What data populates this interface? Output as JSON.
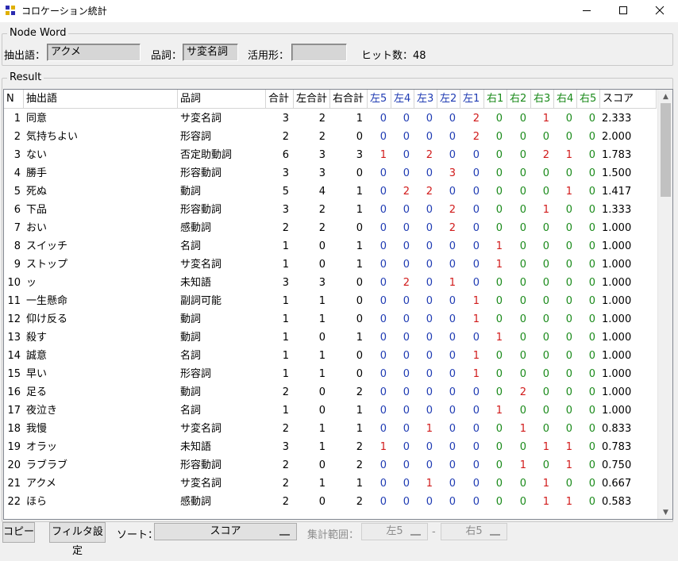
{
  "window": {
    "title": "コロケーション統計",
    "icon": "app-grid-icon",
    "minimize_icon": "minimize-icon",
    "maximize_icon": "maximize-icon",
    "close_icon": "close-icon"
  },
  "node_word": {
    "group_label": "Node Word",
    "extract_label": "抽出語：",
    "extract_value": "アクメ",
    "pos_label": "品詞：",
    "pos_value": "サ変名詞",
    "conj_label": "活用形：",
    "conj_value": "",
    "hits_label": "ヒット数：48"
  },
  "result": {
    "group_label": "Result",
    "columns": [
      "N",
      "抽出語",
      "品詞",
      "合計",
      "左合計",
      "右合計",
      "左5",
      "左4",
      "左3",
      "左2",
      "左1",
      "右1",
      "右2",
      "右3",
      "右4",
      "右5",
      "スコア"
    ],
    "rows": [
      [
        "1",
        "同意",
        "サ変名詞",
        "3",
        "2",
        "1",
        "0",
        "0",
        "0",
        "0",
        "2",
        "0",
        "0",
        "1",
        "0",
        "0",
        "2.333"
      ],
      [
        "2",
        "気持ちよい",
        "形容詞",
        "2",
        "2",
        "0",
        "0",
        "0",
        "0",
        "0",
        "2",
        "0",
        "0",
        "0",
        "0",
        "0",
        "2.000"
      ],
      [
        "3",
        "ない",
        "否定助動詞",
        "6",
        "3",
        "3",
        "1",
        "0",
        "2",
        "0",
        "0",
        "0",
        "0",
        "2",
        "1",
        "0",
        "1.783"
      ],
      [
        "4",
        "勝手",
        "形容動詞",
        "3",
        "3",
        "0",
        "0",
        "0",
        "0",
        "3",
        "0",
        "0",
        "0",
        "0",
        "0",
        "0",
        "1.500"
      ],
      [
        "5",
        "死ぬ",
        "動詞",
        "5",
        "4",
        "1",
        "0",
        "2",
        "2",
        "0",
        "0",
        "0",
        "0",
        "0",
        "1",
        "0",
        "1.417"
      ],
      [
        "6",
        "下品",
        "形容動詞",
        "3",
        "2",
        "1",
        "0",
        "0",
        "0",
        "2",
        "0",
        "0",
        "0",
        "1",
        "0",
        "0",
        "1.333"
      ],
      [
        "7",
        "おい",
        "感動詞",
        "2",
        "2",
        "0",
        "0",
        "0",
        "0",
        "2",
        "0",
        "0",
        "0",
        "0",
        "0",
        "0",
        "1.000"
      ],
      [
        "8",
        "スイッチ",
        "名詞",
        "1",
        "0",
        "1",
        "0",
        "0",
        "0",
        "0",
        "0",
        "1",
        "0",
        "0",
        "0",
        "0",
        "1.000"
      ],
      [
        "9",
        "ストップ",
        "サ変名詞",
        "1",
        "0",
        "1",
        "0",
        "0",
        "0",
        "0",
        "0",
        "1",
        "0",
        "0",
        "0",
        "0",
        "1.000"
      ],
      [
        "10",
        "ッ",
        "未知語",
        "3",
        "3",
        "0",
        "0",
        "2",
        "0",
        "1",
        "0",
        "0",
        "0",
        "0",
        "0",
        "0",
        "1.000"
      ],
      [
        "11",
        "一生懸命",
        "副詞可能",
        "1",
        "1",
        "0",
        "0",
        "0",
        "0",
        "0",
        "1",
        "0",
        "0",
        "0",
        "0",
        "0",
        "1.000"
      ],
      [
        "12",
        "仰け反る",
        "動詞",
        "1",
        "1",
        "0",
        "0",
        "0",
        "0",
        "0",
        "1",
        "0",
        "0",
        "0",
        "0",
        "0",
        "1.000"
      ],
      [
        "13",
        "殺す",
        "動詞",
        "1",
        "0",
        "1",
        "0",
        "0",
        "0",
        "0",
        "0",
        "1",
        "0",
        "0",
        "0",
        "0",
        "1.000"
      ],
      [
        "14",
        "誠意",
        "名詞",
        "1",
        "1",
        "0",
        "0",
        "0",
        "0",
        "0",
        "1",
        "0",
        "0",
        "0",
        "0",
        "0",
        "1.000"
      ],
      [
        "15",
        "早い",
        "形容詞",
        "1",
        "1",
        "0",
        "0",
        "0",
        "0",
        "0",
        "1",
        "0",
        "0",
        "0",
        "0",
        "0",
        "1.000"
      ],
      [
        "16",
        "足る",
        "動詞",
        "2",
        "0",
        "2",
        "0",
        "0",
        "0",
        "0",
        "0",
        "0",
        "2",
        "0",
        "0",
        "0",
        "1.000"
      ],
      [
        "17",
        "夜泣き",
        "名詞",
        "1",
        "0",
        "1",
        "0",
        "0",
        "0",
        "0",
        "0",
        "1",
        "0",
        "0",
        "0",
        "0",
        "1.000"
      ],
      [
        "18",
        "我慢",
        "サ変名詞",
        "2",
        "1",
        "1",
        "0",
        "0",
        "1",
        "0",
        "0",
        "0",
        "1",
        "0",
        "0",
        "0",
        "0.833"
      ],
      [
        "19",
        "オラッ",
        "未知語",
        "3",
        "1",
        "2",
        "1",
        "0",
        "0",
        "0",
        "0",
        "0",
        "0",
        "1",
        "1",
        "0",
        "0.783"
      ],
      [
        "20",
        "ラブラブ",
        "形容動詞",
        "2",
        "0",
        "2",
        "0",
        "0",
        "0",
        "0",
        "0",
        "0",
        "1",
        "0",
        "1",
        "0",
        "0.750"
      ],
      [
        "21",
        "アクメ",
        "サ変名詞",
        "2",
        "1",
        "1",
        "0",
        "0",
        "1",
        "0",
        "0",
        "0",
        "0",
        "1",
        "0",
        "0",
        "0.667"
      ],
      [
        "22",
        "ほら",
        "感動詞",
        "2",
        "0",
        "2",
        "0",
        "0",
        "0",
        "0",
        "0",
        "0",
        "0",
        "1",
        "1",
        "0",
        "0.583"
      ]
    ],
    "colors": {
      "left": "#1f3bb3",
      "right": "#1a8a1a",
      "nonzero": "#d11a1a"
    }
  },
  "footer": {
    "copy_label": "コピー",
    "filter_label": "フィルタ設定",
    "sort_label": "ソート：",
    "sort_value": "スコア",
    "range_label": "集計範囲：",
    "range_from": "左5",
    "range_sep": "-",
    "range_to": "右5"
  }
}
